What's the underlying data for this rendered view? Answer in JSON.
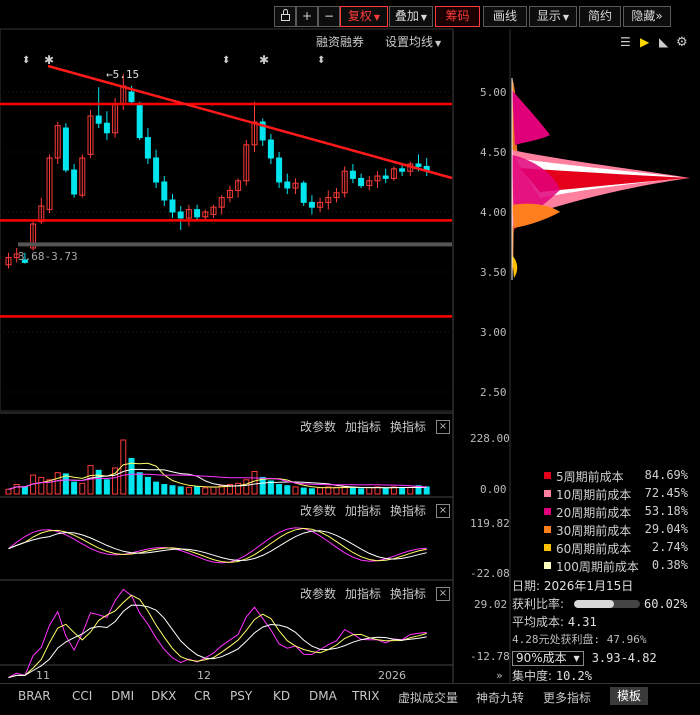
{
  "toolbar": {
    "lock_icon": "lock-icon",
    "plus": "+",
    "minus": "−",
    "fuquan": "复权",
    "diejia": "叠加",
    "chouma": "筹码",
    "huaxian": "画线",
    "xianshi": "显示",
    "jianyue": "简约",
    "yincang": "隐藏",
    "more": "»"
  },
  "main_chart": {
    "rzrq": "融资融券",
    "ma_setting": "设置均线",
    "peak_label": "←5.15",
    "range_label": "3.68-3.73",
    "axis_ticks": [
      "5.00",
      "4.50",
      "4.00",
      "3.50",
      "3.00",
      "2.50"
    ],
    "x_labels": [
      "11",
      "12",
      "2026"
    ],
    "resistance_lines": [
      4.9,
      3.93,
      3.13
    ],
    "support_band": 3.73
  },
  "sub_panels": {
    "change_param": "改参数",
    "add_indicator": "加指标",
    "switch_indicator": "换指标",
    "close": "×",
    "vol_ticks": [
      "228.00",
      "0.00"
    ],
    "ind2_ticks": [
      "119.82",
      "-22.08"
    ],
    "ind3_ticks": [
      "29.02",
      "-12.78"
    ]
  },
  "chip_legend": [
    {
      "name": "5周期前成本",
      "value": "84.69%",
      "color": "#e4001b"
    },
    {
      "name": "10周期前成本",
      "value": "72.45%",
      "color": "#ff7f9f"
    },
    {
      "name": "20周期前成本",
      "value": "53.18%",
      "color": "#e0007a"
    },
    {
      "name": "30周期前成本",
      "value": "29.04%",
      "color": "#ff7f1f"
    },
    {
      "name": "60周期前成本",
      "value": "2.74%",
      "color": "#ffc000"
    },
    {
      "name": "100周期前成本",
      "value": "0.38%",
      "color": "#ffffc0"
    }
  ],
  "info": {
    "date_label": "日期: ",
    "date": "2026年1月15日",
    "profit_label": "获利比率: ",
    "profit_ratio": 0.6002,
    "profit_value": "60.02%",
    "avg_cost_label": "平均成本: ",
    "avg_cost": "4.31",
    "profit_at": "4.28元处获利盘: 47.96%",
    "cost_select": "90%成本",
    "cost_range": "3.93-4.82",
    "concentration_label": "集中度: ",
    "concentration": "10.2%"
  },
  "tabs": [
    "BRAR",
    "CCI",
    "DMI",
    "DKX",
    "CR",
    "PSY",
    "KD",
    "DMA",
    "TRIX",
    "虚拟成交量",
    "神奇九转",
    "更多指标",
    "模板"
  ],
  "active_tab": "模板",
  "colors": {
    "up": "#ff3b3b",
    "down": "#00e5ee",
    "line_red": "#ff0000",
    "yellow": "#ffff66",
    "white": "#ffffff",
    "magenta": "#ff33ff"
  }
}
